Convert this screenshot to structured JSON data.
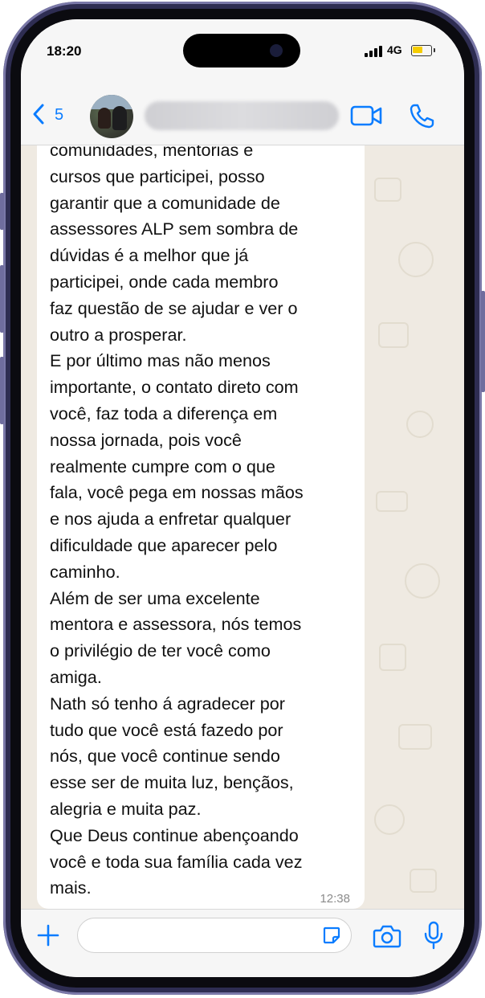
{
  "status": {
    "time": "18:20",
    "network": "4G",
    "battery_percent": 0.6
  },
  "header": {
    "back_count": "5",
    "contact_name": ""
  },
  "message": {
    "lines": [
      "comunidades, mentorias e",
      "cursos que participei, posso",
      "garantir que a comunidade de",
      "assessores ALP sem sombra de",
      "dúvidas é a melhor que já",
      "participei, onde cada membro",
      "faz questão de se ajudar e ver o",
      "outro a prosperar.",
      "E por último mas não menos",
      "importante, o contato direto com",
      "você, faz toda a diferença em",
      "nossa jornada, pois você",
      "realmente cumpre com o que",
      "fala, você pega em nossas mãos",
      "e nos ajuda a enfretar qualquer",
      "dificuldade que aparecer pelo",
      "caminho.",
      "Além de ser uma excelente",
      "mentora e assessora, nós temos",
      "o privilégio de ter você como",
      "amiga.",
      "Nath só tenho á agradecer por",
      "tudo que você está fazedo por",
      "nós, que você continue sendo",
      "esse ser de muita luz, bençãos,",
      "alegria e muita paz.",
      "Que Deus continue abençoando",
      "você e toda sua família cada vez",
      "mais."
    ],
    "time": "12:38"
  },
  "composer": {
    "placeholder": ""
  },
  "colors": {
    "accent": "#0a7cff",
    "chat_bg": "#efeae2",
    "bubble": "#ffffff",
    "battery": "#f5cc00"
  },
  "icons": [
    "chevron-left-icon",
    "video-camera-icon",
    "phone-icon",
    "plus-icon",
    "sticker-icon",
    "camera-icon",
    "microphone-icon"
  ]
}
